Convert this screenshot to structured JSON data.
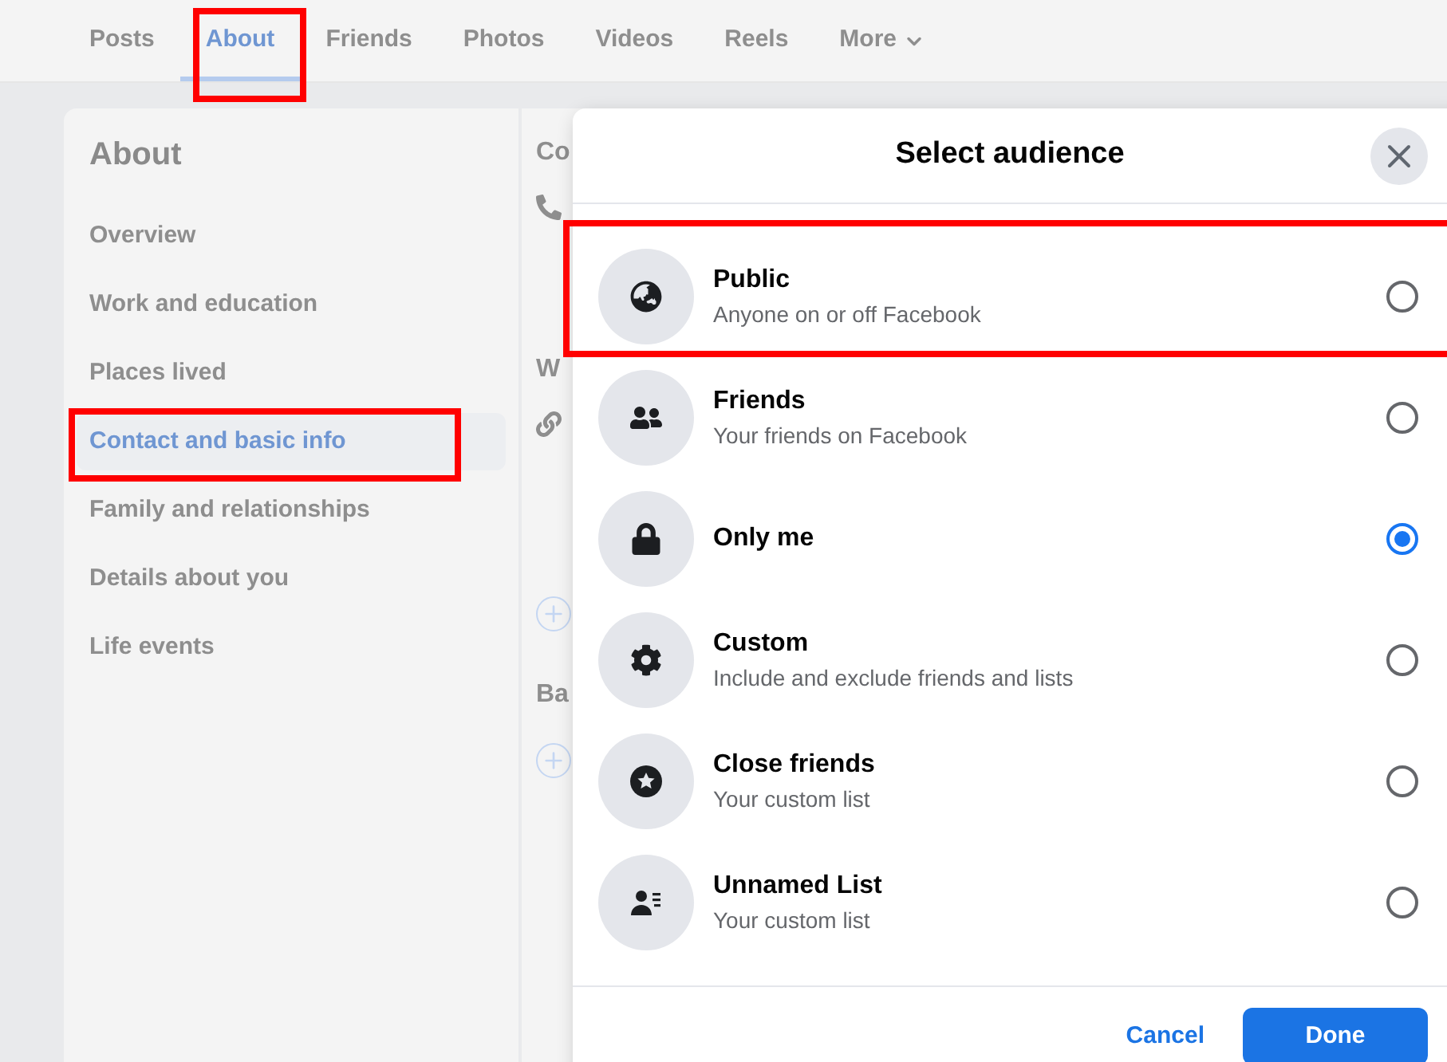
{
  "tabs": [
    {
      "label": "Posts",
      "selected": false,
      "highlighted": false
    },
    {
      "label": "About",
      "selected": true,
      "highlighted": true
    },
    {
      "label": "Friends",
      "selected": false,
      "highlighted": false
    },
    {
      "label": "Photos",
      "selected": false,
      "highlighted": false
    },
    {
      "label": "Videos",
      "selected": false,
      "highlighted": false
    },
    {
      "label": "Reels",
      "selected": false,
      "highlighted": false
    },
    {
      "label": "More",
      "selected": false,
      "highlighted": false,
      "kind": "menu"
    }
  ],
  "sidebar": {
    "title": "About",
    "items": [
      {
        "label": "Overview",
        "selected": false,
        "highlighted": false
      },
      {
        "label": "Work and education",
        "selected": false,
        "highlighted": false
      },
      {
        "label": "Places lived",
        "selected": false,
        "highlighted": false
      },
      {
        "label": "Contact and basic info",
        "selected": true,
        "highlighted": true
      },
      {
        "label": "Family and relationships",
        "selected": false,
        "highlighted": false
      },
      {
        "label": "Details about you",
        "selected": false,
        "highlighted": false
      },
      {
        "label": "Life events",
        "selected": false,
        "highlighted": false
      }
    ]
  },
  "content_headings": [
    "Co",
    "W",
    "Ba"
  ],
  "dialog": {
    "title": "Select audience",
    "options": [
      {
        "kind": "public",
        "label": "Public",
        "description": "Anyone on or off Facebook",
        "selected": false,
        "highlighted": true
      },
      {
        "kind": "friends",
        "label": "Friends",
        "description": "Your friends on Facebook",
        "selected": false,
        "highlighted": false
      },
      {
        "kind": "private",
        "label": "Only me",
        "selected": true,
        "highlighted": false
      },
      {
        "kind": "custom",
        "label": "Custom",
        "description": "Include and exclude friends and lists",
        "selected": false,
        "highlighted": false
      },
      {
        "kind": "close",
        "label": "Close friends",
        "description": "Your custom list",
        "selected": false,
        "highlighted": false
      },
      {
        "kind": "list",
        "label": "Unnamed List",
        "description": "Your custom list",
        "selected": false,
        "highlighted": false
      }
    ],
    "cancel": "Cancel",
    "done": "Done"
  }
}
